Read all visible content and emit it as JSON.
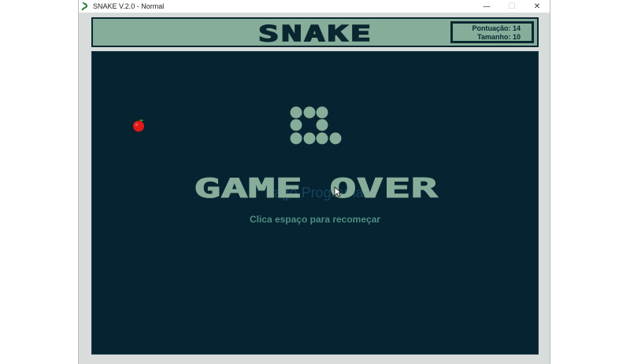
{
  "window": {
    "title": "SNAKE V.2.0 - Normal",
    "controls": {
      "minimize": "—",
      "maximize": "☐",
      "close": "✕"
    }
  },
  "header": {
    "logo_text": "SNAKE",
    "score_label": "Pontuação: 14",
    "size_label": "Tamanho: 10"
  },
  "game": {
    "state": "game over",
    "game_over_text": "GAME OVER",
    "restart_hint": "Clica espaço para recomeçar",
    "watermark": "Tiago Programas",
    "snake_length": 10,
    "score": 14,
    "apple_icon": "apple-icon",
    "colors": {
      "board": "#052330",
      "snake": "#86ad9a",
      "header": "#86ad9a",
      "text_dark": "#0a2730",
      "apple": "#e11818"
    }
  }
}
